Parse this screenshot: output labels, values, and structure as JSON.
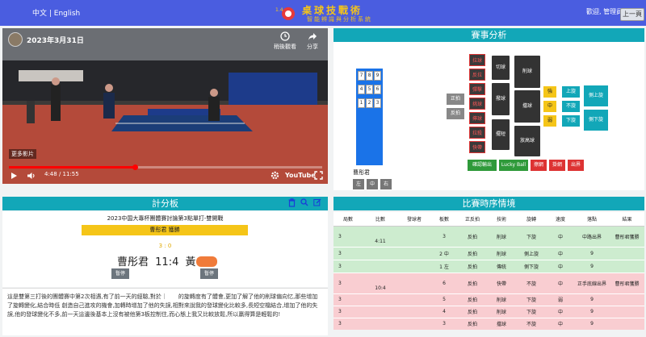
{
  "header": {
    "lang": "中文 | English",
    "logo_title": "桌球技戰術",
    "logo_sub": "智能辨識與分析系統",
    "logo_mark": "1.4 TTTACT",
    "user": "歡迎, 管理員",
    "page_button": "上一頁"
  },
  "video": {
    "date": "2023年3月31日",
    "watch_later": "稍後觀看",
    "share": "分享",
    "more_videos": "更多影片",
    "time": "4:48 / 11:55",
    "progress": 0.403,
    "brand": "YouTube"
  },
  "analysis": {
    "title": "賽事分析",
    "keys": [
      "7",
      "8",
      "9",
      "4",
      "5",
      "6",
      "1",
      "2",
      "3"
    ],
    "player": "曹彤君",
    "positions": [
      "左",
      "中",
      "右"
    ],
    "sides": [
      "正拍",
      "反拍"
    ],
    "red_items": [
      "拉球",
      "反拉",
      "彈擊",
      "挑球",
      "擰球",
      "拉殺",
      "快帶",
      "對拉"
    ],
    "mid_items": [
      "切球",
      "撥球",
      "擺短"
    ],
    "tech_items": [
      "削球",
      "擋球",
      "放高球"
    ],
    "spin_items": [
      "強",
      "中",
      "弱"
    ],
    "rotation_items": [
      "上旋",
      "不旋",
      "下旋"
    ],
    "side_spin": [
      "側上旋",
      "側下旋"
    ],
    "result_buttons": [
      "確認輸出",
      "Lucky Ball",
      "擦網",
      "掛網",
      "出界"
    ]
  },
  "scoreboard": {
    "title": "計分板",
    "match": "2023中国大專杯團體賽討論第3點單打-雙開戰",
    "winner": "曹彤君 獲勝",
    "games": "3 : 0",
    "player_a": "曹彤君",
    "score": "11:4",
    "player_b": "黃",
    "pause_a": "暫停",
    "pause_b": "暫停",
    "commentary": "這是雙第三打後的團體賽中第2次相遇,有了前一天的經驗,對於｜　　的旋轉度有了體會,更加了解了他的削球偏向忆,那些增加了旋轉變化,結合時低 創造自己進攻的機會,加轉時增加了他的失誤,相對來說我的發球變化比較多,長短空檔結合,增加了他的失誤,他的發球變化不多,前一天這邊後基本上沒有被他第3板控制住,而心態上我又比較放鬆,所以贏得算是輕鬆的!"
  },
  "sequence": {
    "title": "比賽時序情境",
    "columns": [
      "局數",
      "比數",
      "發球者",
      "板數",
      "正反拍",
      "技術",
      "旋轉",
      "速度",
      "落點",
      "結果"
    ],
    "rows": [
      {
        "c": "g",
        "cells": [
          "3",
          "4:11",
          "",
          "3",
          "反拍",
          "削球",
          "下旋",
          "中",
          "中路出界",
          "曹彤君獲勝"
        ]
      },
      {
        "c": "g",
        "cells": [
          "3",
          "",
          "",
          "2 中",
          "反拍",
          "削球",
          "側上旋",
          "中",
          "9",
          ""
        ]
      },
      {
        "c": "g",
        "cells": [
          "3",
          "",
          "",
          "1 左",
          "反拍",
          "傳統",
          "側下旋",
          "中",
          "9",
          ""
        ]
      },
      {
        "c": "p",
        "cells": [
          "3",
          "10:4",
          "",
          "6",
          "反拍",
          "快帶",
          "不旋",
          "中",
          "正手底線出界",
          "曹彤君獲勝"
        ]
      },
      {
        "c": "p",
        "cells": [
          "3",
          "",
          "",
          "5",
          "反拍",
          "削球",
          "下旋",
          "弱",
          "9",
          ""
        ]
      },
      {
        "c": "p",
        "cells": [
          "3",
          "",
          "",
          "4",
          "反拍",
          "削球",
          "下旋",
          "中",
          "9",
          ""
        ]
      },
      {
        "c": "p",
        "cells": [
          "3",
          "",
          "",
          "3",
          "反拍",
          "擋球",
          "不旋",
          "中",
          "9",
          ""
        ]
      }
    ]
  },
  "colors": {
    "primary": "#4a5de0",
    "teal": "#12a7b8",
    "yellow": "#f5c518",
    "green_row": "#cdeccf",
    "pink_row": "#f9cdd1"
  }
}
